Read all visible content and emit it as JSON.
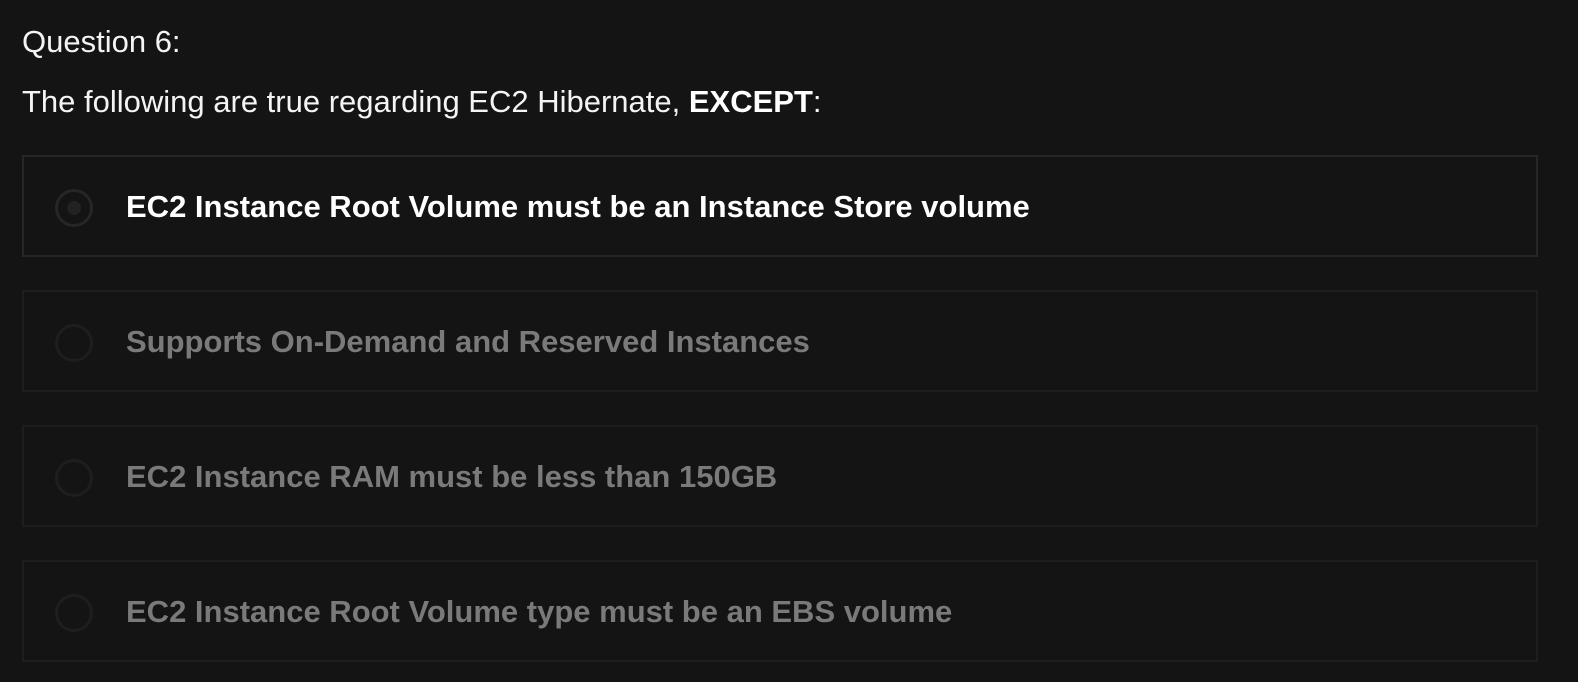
{
  "question": {
    "number_label": "Question 6:",
    "text_prefix": "The following are true regarding EC2 Hibernate, ",
    "text_emphasis": "EXCEPT",
    "text_suffix": ":"
  },
  "options": [
    {
      "label": "EC2 Instance Root Volume must be an Instance Store volume",
      "selected": true
    },
    {
      "label": "Supports On-Demand and Reserved Instances",
      "selected": false
    },
    {
      "label": "EC2 Instance RAM must be less than 150GB",
      "selected": false
    },
    {
      "label": "EC2 Instance Root Volume type must be an EBS volume",
      "selected": false
    }
  ],
  "colors": {
    "background": "#141414",
    "text_primary": "#ffffff",
    "text_dim": "#7a7a7a",
    "border": "#1e1e1e"
  }
}
